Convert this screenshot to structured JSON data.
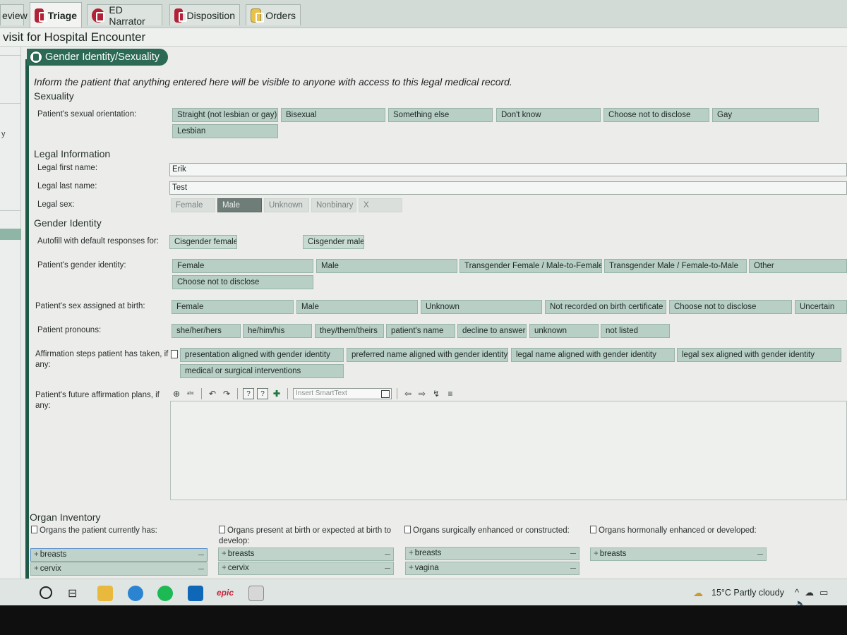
{
  "tabs": [
    {
      "label": "eview",
      "icon": "none"
    },
    {
      "label": "Triage",
      "icon": "triage-icon"
    },
    {
      "label": "ED Narrator",
      "icon": "narrator-icon"
    },
    {
      "label": "Disposition",
      "icon": "disposition-icon"
    },
    {
      "label": "Orders",
      "icon": "orders-icon"
    }
  ],
  "window_title": "visit for Hospital Encounter",
  "section": {
    "title": "Gender Identity/Sexuality",
    "icon": "section-icon"
  },
  "notice": "Inform the patient that anything entered here will be visible to anyone with access to this legal medical record.",
  "sexuality": {
    "heading": "Sexuality",
    "orientation_label": "Patient's sexual orientation:",
    "orientation_options": [
      "Straight (not lesbian or gay)",
      "Bisexual",
      "Something else",
      "Don't know",
      "Choose not to disclose",
      "Gay",
      "Lesbian"
    ]
  },
  "legal": {
    "heading": "Legal Information",
    "first_name_label": "Legal first name:",
    "first_name": "Erik",
    "last_name_label": "Legal last name:",
    "last_name": "Test",
    "sex_label": "Legal sex:",
    "sex_options": [
      "Female",
      "Male",
      "Unknown",
      "Nonbinary",
      "X"
    ],
    "sex_selected": "Male"
  },
  "gender": {
    "heading": "Gender Identity",
    "autofill_label": "Autofill with default responses for:",
    "autofill_options": [
      "Cisgender female",
      "Cisgender male"
    ],
    "identity_label": "Patient's gender identity:",
    "identity_options": [
      "Female",
      "Male",
      "Transgender Female / Male-to-Female",
      "Transgender Male / Female-to-Male",
      "Other",
      "Choose not to disclose"
    ],
    "birth_sex_label": "Patient's sex assigned at birth:",
    "birth_sex_options": [
      "Female",
      "Male",
      "Unknown",
      "Not recorded on birth certificate",
      "Choose not to disclose",
      "Uncertain"
    ],
    "pronouns_label": "Patient pronouns:",
    "pronoun_options": [
      "she/her/hers",
      "he/him/his",
      "they/them/theirs",
      "patient's name",
      "decline to answer",
      "unknown",
      "not listed"
    ],
    "affirmation_label": "Affirmation steps patient has taken, if any:",
    "affirmation_options": [
      "presentation aligned with gender identity",
      "preferred name aligned with gender identity",
      "legal name aligned with gender identity",
      "legal sex aligned with gender identity",
      "medical or surgical interventions"
    ],
    "future_label": "Patient's future affirmation plans, if any:",
    "smarttext_placeholder": "Insert SmartText"
  },
  "organ_inventory": {
    "heading": "Organ Inventory",
    "columns": [
      {
        "header": "Organs the patient currently has:",
        "items": [
          "breasts",
          "cervix"
        ]
      },
      {
        "header": "Organs present at birth or expected at birth to develop:",
        "items": [
          "breasts",
          "cervix"
        ]
      },
      {
        "header": "Organs surgically enhanced or constructed:",
        "items": [
          "breasts",
          "vagina"
        ]
      },
      {
        "header": "Organs hormonally enhanced or developed:",
        "items": [
          "breasts"
        ]
      }
    ]
  },
  "taskbar": {
    "weather": "15°C  Partly cloudy",
    "epic_label": "epic"
  },
  "colors": {
    "accent": "#2c6a55",
    "chip": "#b8cfc6",
    "selected_chip": "#6f7d78"
  }
}
